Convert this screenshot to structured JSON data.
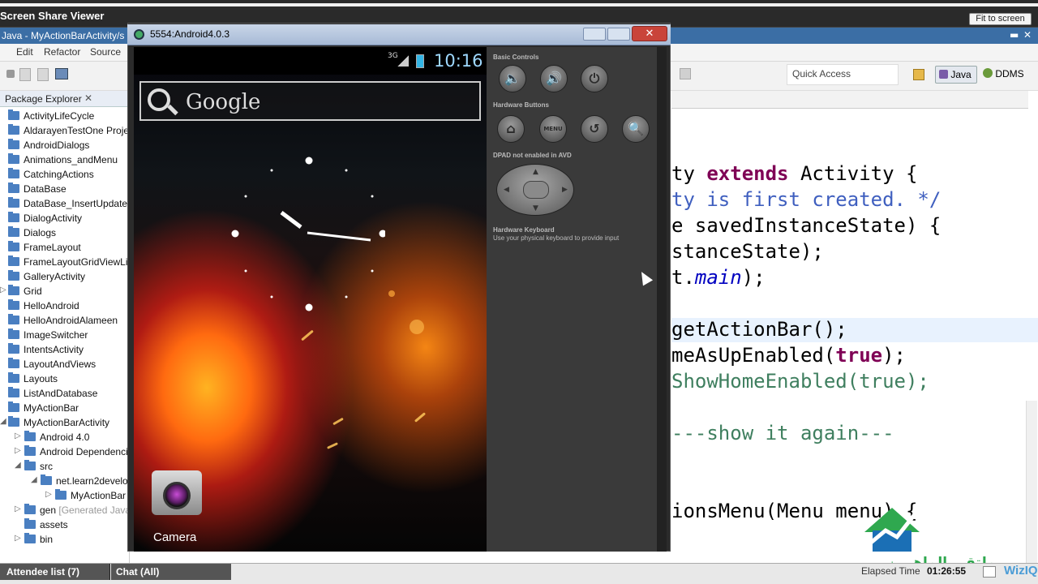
{
  "viewer": {
    "title": "Screen Share Viewer",
    "fit_button": "Fit to screen"
  },
  "eclipse": {
    "window_title": "Java - MyActionBarActivity/s",
    "menu": [
      "Edit",
      "Refactor",
      "Source"
    ],
    "quick_access": "Quick Access",
    "perspectives": [
      "Java",
      "DDMS"
    ]
  },
  "package_explorer": {
    "title": "Package Explorer",
    "items": [
      {
        "label": "ActivityLifeCycle"
      },
      {
        "label": "AldarayenTestOne Proje"
      },
      {
        "label": "AndroidDialogs"
      },
      {
        "label": "Animations_andMenu"
      },
      {
        "label": "CatchingActions"
      },
      {
        "label": "DataBase"
      },
      {
        "label": "DataBase_InsertUpdateD"
      },
      {
        "label": "DialogActivity"
      },
      {
        "label": "Dialogs"
      },
      {
        "label": "FrameLayout"
      },
      {
        "label": "FrameLayoutGridViewLi"
      },
      {
        "label": "GalleryActivity"
      },
      {
        "label": "Grid"
      },
      {
        "label": "HelloAndroid"
      },
      {
        "label": "HelloAndroidAlameen"
      },
      {
        "label": "ImageSwitcher"
      },
      {
        "label": "IntentsActivity"
      },
      {
        "label": "LayoutAndViews"
      },
      {
        "label": "Layouts"
      },
      {
        "label": "ListAndDatabase"
      },
      {
        "label": "MyActionBar"
      },
      {
        "label": "MyActionBarActivity"
      },
      {
        "label": "Android 4.0"
      },
      {
        "label": "Android Dependenci"
      },
      {
        "label": "src"
      },
      {
        "label": "net.learn2develo"
      },
      {
        "label": "MyActionBar"
      },
      {
        "label": "gen",
        "note": "[Generated Java"
      },
      {
        "label": "assets"
      },
      {
        "label": "bin"
      }
    ]
  },
  "code": {
    "lines": [
      {
        "parts": [
          {
            "t": "ty ",
            "c": ""
          },
          {
            "t": "extends",
            "c": "kw"
          },
          {
            "t": " Activity {",
            "c": ""
          }
        ]
      },
      {
        "parts": [
          {
            "t": "ty is first created. */",
            "c": "cm"
          }
        ]
      },
      {
        "parts": [
          {
            "t": "e savedInstanceState) {",
            "c": ""
          }
        ]
      },
      {
        "parts": [
          {
            "t": "stanceState);",
            "c": ""
          }
        ]
      },
      {
        "parts": [
          {
            "t": "t.",
            "c": ""
          },
          {
            "t": "main",
            "c": "it"
          },
          {
            "t": ");",
            "c": ""
          }
        ]
      },
      {
        "parts": [
          {
            "t": "",
            "c": ""
          }
        ]
      },
      {
        "parts": [
          {
            "t": "getActionBar();",
            "c": ""
          }
        ]
      },
      {
        "parts": [
          {
            "t": "meAsUpEnabled(",
            "c": ""
          },
          {
            "t": "true",
            "c": "kw"
          },
          {
            "t": ");",
            "c": ""
          }
        ]
      },
      {
        "parts": [
          {
            "t": "ShowHomeEnabled(true);",
            "c": "gc"
          }
        ]
      },
      {
        "parts": [
          {
            "t": "",
            "c": ""
          }
        ]
      },
      {
        "parts": [
          {
            "t": "---show it again---",
            "c": "gc"
          }
        ]
      },
      {
        "parts": [
          {
            "t": "",
            "c": ""
          }
        ]
      },
      {
        "parts": [
          {
            "t": "",
            "c": ""
          }
        ]
      },
      {
        "parts": [
          {
            "t": "ionsMenu(Menu menu) {",
            "c": ""
          }
        ]
      }
    ]
  },
  "emulator": {
    "title": "5554:Android4.0.3",
    "network_label": "3G",
    "clock": "10:16",
    "search_label": "Google",
    "app_label": "Camera",
    "controls": {
      "basic_heading": "Basic Controls",
      "hardware_heading": "Hardware Buttons",
      "dpad_note": "DPAD not enabled in AVD",
      "keyboard_heading": "Hardware Keyboard",
      "keyboard_note": "Use your physical keyboard to provide input",
      "menu_button": "MENU"
    }
  },
  "bottom": {
    "attendee_tab": "Attendee list (7)",
    "chat_tab": "Chat (All)",
    "elapsed_label": "Elapsed Time",
    "elapsed_value": "01:26:55",
    "brand": "WizIQ"
  },
  "watermark": {
    "text": "ملتقى الماهرين"
  }
}
